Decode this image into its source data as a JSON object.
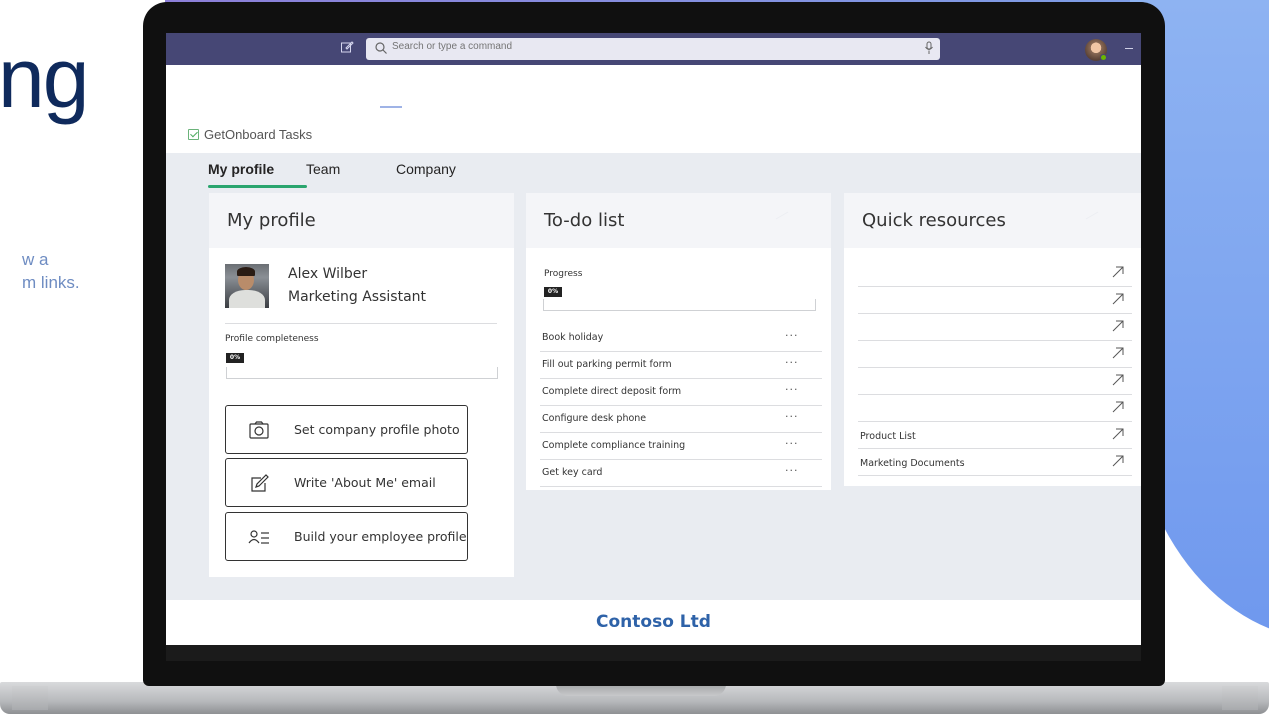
{
  "background": {
    "heading": "ng",
    "description_lines": "w a\nm links."
  },
  "topbar": {
    "search_placeholder": "Search or type a command",
    "icons": [
      "compose-icon",
      "search-icon",
      "mic-icon",
      "avatar"
    ],
    "bar_color": "#464775"
  },
  "app": {
    "title": "GetOnboard Tasks",
    "tabs": [
      {
        "label": "My profile",
        "active": true
      },
      {
        "label": "Team",
        "active": false
      },
      {
        "label": "Company",
        "active": false
      }
    ],
    "accent_color": "#2aa56e"
  },
  "profile_card": {
    "title": "My profile",
    "name": "Alex Wilber",
    "role": "Marketing Assistant",
    "completeness_label": "Profile completeness",
    "completeness_value": "0%",
    "completeness_fraction": 0,
    "actions": [
      {
        "label": "Set company profile photo",
        "icon": "camera-icon"
      },
      {
        "label": "Write 'About Me' email",
        "icon": "edit-icon"
      },
      {
        "label": "Build your employee profile",
        "icon": "person-list-icon"
      }
    ]
  },
  "todo_card": {
    "title": "To-do list",
    "progress_label": "Progress",
    "progress_value": "0%",
    "progress_fraction": 0,
    "more_label": "···",
    "items": [
      "Book holiday",
      "Fill out parking permit form",
      "Complete direct deposit form",
      "Configure desk phone",
      "Complete compliance training",
      "Get key card"
    ]
  },
  "resources_card": {
    "title": "Quick resources",
    "items": [
      "",
      "",
      "",
      "",
      "",
      "",
      "Product List",
      "Marketing Documents"
    ]
  },
  "footer": {
    "company": "Contoso Ltd"
  }
}
